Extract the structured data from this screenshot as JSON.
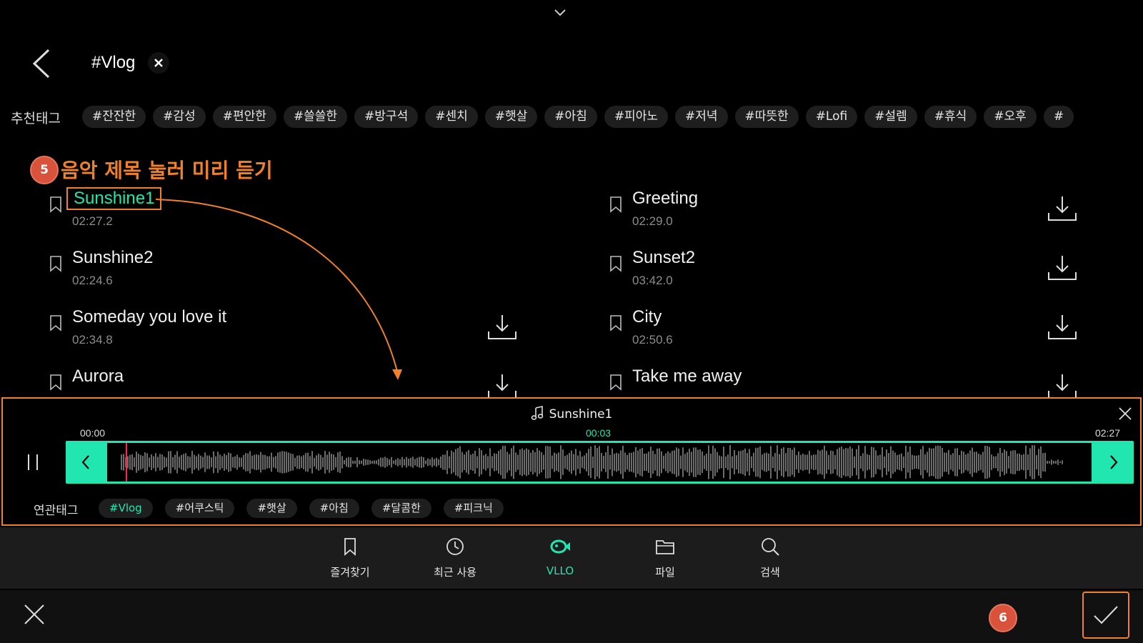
{
  "header": {
    "search_query": "#Vlog"
  },
  "recommended_tags": {
    "label": "추천태그",
    "tags": [
      "#잔잔한",
      "#감성",
      "#편안한",
      "#쓸쓸한",
      "#방구석",
      "#센치",
      "#햇살",
      "#아침",
      "#피아노",
      "#저녁",
      "#따뜻한",
      "#Lofi",
      "#설렘",
      "#휴식",
      "#오후",
      "#"
    ]
  },
  "annotations": {
    "step5_number": "5",
    "step5_text": "음악 제목 눌러 미리 듣기",
    "step6_number": "6"
  },
  "music_list": [
    {
      "title": "Sunshine1",
      "duration": "02:27.2",
      "selected": true,
      "downloadable": false
    },
    {
      "title": "Greeting",
      "duration": "02:29.0",
      "selected": false,
      "downloadable": true
    },
    {
      "title": "Sunshine2",
      "duration": "02:24.6",
      "selected": false,
      "downloadable": false
    },
    {
      "title": "Sunset2",
      "duration": "03:42.0",
      "selected": false,
      "downloadable": true
    },
    {
      "title": "Someday you love it",
      "duration": "02:34.8",
      "selected": false,
      "downloadable": true
    },
    {
      "title": "City",
      "duration": "02:50.6",
      "selected": false,
      "downloadable": true
    },
    {
      "title": "Aurora",
      "duration": "",
      "selected": false,
      "downloadable": true
    },
    {
      "title": "Take me away",
      "duration": "",
      "selected": false,
      "downloadable": true
    }
  ],
  "player": {
    "title": "Sunshine1",
    "time_start": "00:00",
    "time_current": "00:03",
    "time_end": "02:27",
    "playhead_fraction": 0.019,
    "related_label": "연관태그",
    "related_tags": [
      "#Vlog",
      "#어쿠스틱",
      "#햇살",
      "#아침",
      "#달콤한",
      "#피크닉"
    ],
    "active_related_tag": "#Vlog"
  },
  "bottom_nav": [
    {
      "label": "즐겨찾기",
      "icon": "bookmark-icon",
      "active": false
    },
    {
      "label": "최근 사용",
      "icon": "history-icon",
      "active": false
    },
    {
      "label": "VLLO",
      "icon": "vllo-fish-icon",
      "active": true
    },
    {
      "label": "파일",
      "icon": "folder-icon",
      "active": false
    },
    {
      "label": "검색",
      "icon": "search-icon",
      "active": false
    }
  ],
  "colors": {
    "accent": "#21e6b0",
    "annotation": "#f0812a",
    "badge": "#d9523b",
    "playhead": "#ff2448"
  }
}
